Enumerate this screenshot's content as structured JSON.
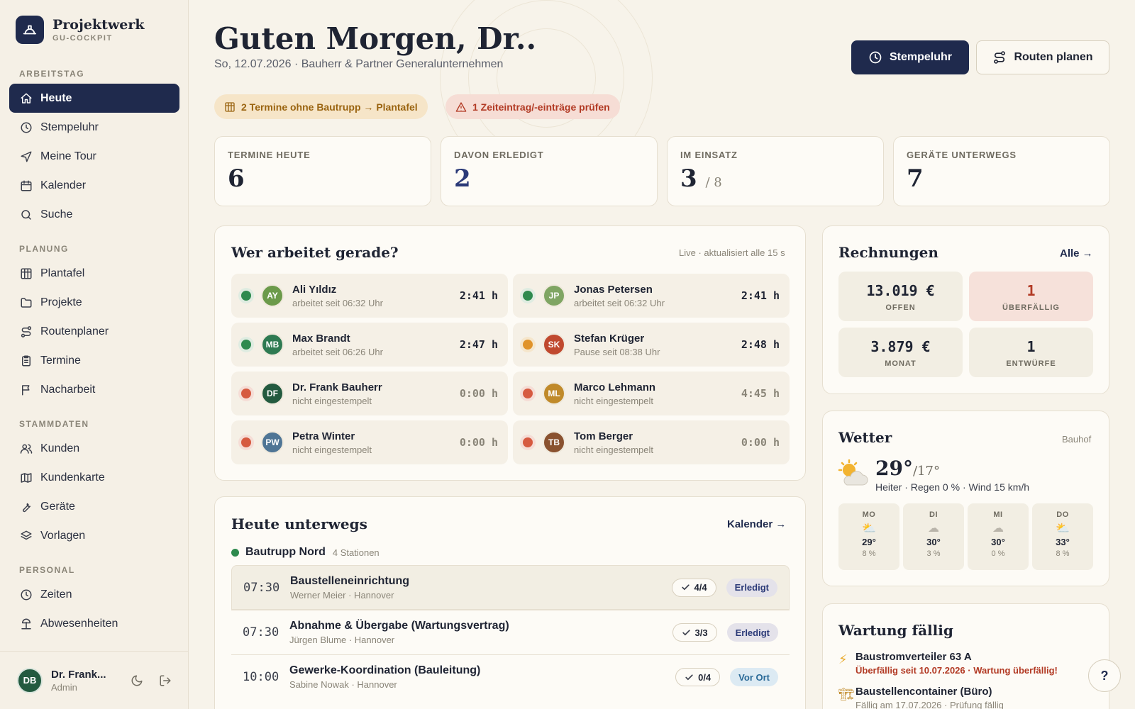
{
  "brand": {
    "title": "Projektwerk",
    "subtitle": "GU-COCKPIT"
  },
  "nav": {
    "sections": [
      {
        "label": "ARBEITSTAG",
        "items": [
          {
            "label": "Heute",
            "icon": "home-icon",
            "active": true
          },
          {
            "label": "Stempeluhr",
            "icon": "clock-icon"
          },
          {
            "label": "Meine Tour",
            "icon": "navigation-icon"
          },
          {
            "label": "Kalender",
            "icon": "calendar-icon"
          },
          {
            "label": "Suche",
            "icon": "search-icon"
          }
        ]
      },
      {
        "label": "PLANUNG",
        "items": [
          {
            "label": "Plantafel",
            "icon": "grid-icon"
          },
          {
            "label": "Projekte",
            "icon": "folder-icon"
          },
          {
            "label": "Routenplaner",
            "icon": "route-icon"
          },
          {
            "label": "Termine",
            "icon": "clipboard-icon"
          },
          {
            "label": "Nacharbeit",
            "icon": "flag-icon"
          }
        ]
      },
      {
        "label": "STAMMDATEN",
        "items": [
          {
            "label": "Kunden",
            "icon": "users-icon"
          },
          {
            "label": "Kundenkarte",
            "icon": "map-icon"
          },
          {
            "label": "Geräte",
            "icon": "wrench-icon"
          },
          {
            "label": "Vorlagen",
            "icon": "layers-icon"
          }
        ]
      },
      {
        "label": "PERSONAL",
        "items": [
          {
            "label": "Zeiten",
            "icon": "clock-icon"
          },
          {
            "label": "Abwesenheiten",
            "icon": "beach-icon"
          }
        ]
      }
    ]
  },
  "user": {
    "initials": "DB",
    "name": "Dr. Frank...",
    "role": "Admin"
  },
  "header": {
    "greeting": "Guten Morgen, Dr..",
    "subline": "So, 12.07.2026 · Bauherr & Partner Generalunternehmen",
    "btn_clock": "Stempeluhr",
    "btn_routes": "Routen planen"
  },
  "alerts": {
    "amber": "2 Termine ohne Bautrupp → Plantafel",
    "red": "1 Zeiteintrag/-einträge prüfen"
  },
  "stats": {
    "termine_label": "TERMINE HEUTE",
    "termine_value": "6",
    "erledigt_label": "DAVON ERLEDIGT",
    "erledigt_value": "2",
    "einsatz_label": "IM EINSATZ",
    "einsatz_value": "3",
    "einsatz_total": "/ 8",
    "geraete_label": "GERÄTE UNTERWEGS",
    "geraete_value": "7"
  },
  "workers": {
    "title": "Wer arbeitet gerade?",
    "meta": "Live · aktualisiert alle 15 s",
    "list": [
      {
        "initials": "AY",
        "name": "Ali Yıldız",
        "status": "arbeitet seit 06:32 Uhr",
        "time": "2:41 h",
        "state": "green",
        "avatar_color": "#6b9a4a",
        "dim": false
      },
      {
        "initials": "JP",
        "name": "Jonas Petersen",
        "status": "arbeitet seit 06:32 Uhr",
        "time": "2:41 h",
        "state": "green",
        "avatar_color": "#7fa563",
        "dim": false
      },
      {
        "initials": "MB",
        "name": "Max Brandt",
        "status": "arbeitet seit 06:26 Uhr",
        "time": "2:47 h",
        "state": "green",
        "avatar_color": "#2e7a52",
        "dim": false
      },
      {
        "initials": "SK",
        "name": "Stefan Krüger",
        "status": "Pause seit 08:38 Uhr",
        "time": "2:48 h",
        "state": "amber",
        "avatar_color": "#c0492f",
        "dim": false
      },
      {
        "initials": "DF",
        "name": "Dr. Frank Bauherr",
        "status": "nicht eingestempelt",
        "time": "0:00 h",
        "state": "red",
        "avatar_color": "#235a3f",
        "dim": true
      },
      {
        "initials": "ML",
        "name": "Marco Lehmann",
        "status": "nicht eingestempelt",
        "time": "4:45 h",
        "state": "red",
        "avatar_color": "#c08a2a",
        "dim": true
      },
      {
        "initials": "PW",
        "name": "Petra Winter",
        "status": "nicht eingestempelt",
        "time": "0:00 h",
        "state": "red",
        "avatar_color": "#4f7595",
        "dim": true
      },
      {
        "initials": "TB",
        "name": "Tom Berger",
        "status": "nicht eingestempelt",
        "time": "0:00 h",
        "state": "red",
        "avatar_color": "#8a5230",
        "dim": true
      }
    ]
  },
  "invoices": {
    "title": "Rechnungen",
    "link": "Alle →",
    "open_value": "13.019 €",
    "open_label": "OFFEN",
    "overdue_value": "1",
    "overdue_label": "ÜBERFÄLLIG",
    "month_value": "3.879 €",
    "month_label": "MONAT",
    "drafts_value": "1",
    "drafts_label": "ENTWÜRFE"
  },
  "weather": {
    "title": "Wetter",
    "location": "Bauhof",
    "temp": "29°",
    "low": "/17°",
    "desc": "Heiter · Regen 0 % · Wind 15 km/h",
    "days": [
      {
        "name": "MO",
        "icon": "⛅",
        "temp": "29°",
        "rain": "8 %"
      },
      {
        "name": "DI",
        "icon": "☁",
        "temp": "30°",
        "rain": "3 %"
      },
      {
        "name": "MI",
        "icon": "☁",
        "temp": "30°",
        "rain": "0 %"
      },
      {
        "name": "DO",
        "icon": "⛅",
        "temp": "33°",
        "rain": "8 %"
      }
    ]
  },
  "route": {
    "title": "Heute unterwegs",
    "link": "Kalender →",
    "team": "Bautrupp Nord",
    "team_count": "4 Stationen",
    "stops": [
      {
        "time": "07:30",
        "title": "Baustelleneinrichtung",
        "sub": "Werner Meier · Hannover",
        "check": "4/4",
        "status": "Erledigt",
        "kind": "done"
      },
      {
        "time": "07:30",
        "title": "Abnahme & Übergabe (Wartungsvertrag)",
        "sub": "Jürgen Blume · Hannover",
        "check": "3/3",
        "status": "Erledigt",
        "kind": "done"
      },
      {
        "time": "10:00",
        "title": "Gewerke-Koordination (Bauleitung)",
        "sub": "Sabine Nowak · Hannover",
        "check": "0/4",
        "status": "Vor Ort",
        "kind": "site"
      }
    ]
  },
  "maintenance": {
    "title": "Wartung fällig",
    "items": [
      {
        "icon": "⚡",
        "title": "Baustromverteiler 63 A",
        "sub": "Überfällig seit 10.07.2026 · Wartung überfällig!",
        "overdue": true
      },
      {
        "icon": "🏗",
        "title": "Baustellencontainer (Büro)",
        "sub": "Fällig am 17.07.2026 · Prüfung fällig",
        "overdue": false
      }
    ]
  },
  "help_label": "?"
}
